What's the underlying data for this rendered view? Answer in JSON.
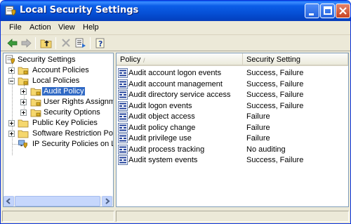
{
  "window": {
    "title": "Local Security Settings",
    "title_icon": "security-settings-icon"
  },
  "menu": [
    "File",
    "Action",
    "View",
    "Help"
  ],
  "toolbar": {
    "buttons": [
      "back-icon",
      "forward-icon",
      "up-folder-icon",
      "delete-icon",
      "export-list-icon",
      "help-icon"
    ]
  },
  "tree": {
    "root": "Security Settings",
    "account_policies": "Account Policies",
    "local_policies": "Local Policies",
    "audit_policy": "Audit Policy",
    "user_rights": "User Rights Assignmen",
    "security_options": "Security Options",
    "public_key": "Public Key Policies",
    "software_restriction": "Software Restriction Policie",
    "ip_security": "IP Security Policies on Loca"
  },
  "table": {
    "columns": [
      "Policy",
      "Security Setting"
    ],
    "rows": [
      {
        "policy": "Audit account logon events",
        "setting": "Success, Failure"
      },
      {
        "policy": "Audit account management",
        "setting": "Success, Failure"
      },
      {
        "policy": "Audit directory service access",
        "setting": "Success, Failure"
      },
      {
        "policy": "Audit logon events",
        "setting": "Success, Failure"
      },
      {
        "policy": "Audit object access",
        "setting": "Failure"
      },
      {
        "policy": "Audit policy change",
        "setting": "Failure"
      },
      {
        "policy": "Audit privilege use",
        "setting": "Failure"
      },
      {
        "policy": "Audit process tracking",
        "setting": "No auditing"
      },
      {
        "policy": "Audit system events",
        "setting": "Success, Failure"
      }
    ]
  },
  "colors": {
    "selection": "#316ac5",
    "titlebar": "#0a5ff0",
    "chrome": "#ece9d8"
  }
}
